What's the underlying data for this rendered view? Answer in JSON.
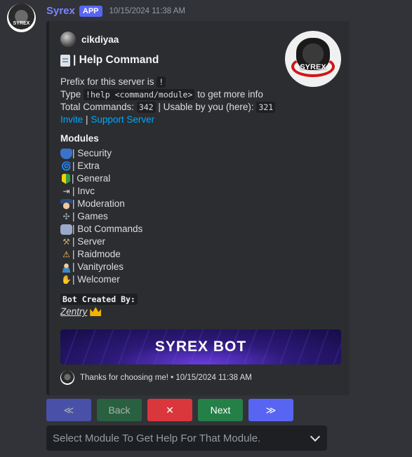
{
  "message": {
    "author": "Syrex",
    "badge": "APP",
    "timestamp": "10/15/2024 11:38 AM",
    "avatar_text": "SYREX"
  },
  "embed": {
    "author_name": "cikdiyaa",
    "thumbnail_text": "SYREX",
    "title": "| Help Command",
    "prefix_text": "Prefix for this server is",
    "prefix_value": "!",
    "type_text": "Type",
    "type_code": "!help <command/module>",
    "type_suffix": "to get more info",
    "total_label": "Total Commands:",
    "total_value": "342",
    "usable_label": "| Usable by you (here):",
    "usable_value": "321",
    "invite_label": "Invite",
    "separator": "|",
    "support_label": "Support Server",
    "modules_title": "Modules",
    "modules": [
      {
        "label": "| Security",
        "icon": "shield-icon"
      },
      {
        "label": "| Extra",
        "icon": "cyclone-icon"
      },
      {
        "label": "| General",
        "icon": "beginner-icon"
      },
      {
        "label": "| Invc",
        "icon": "arrow-icon"
      },
      {
        "label": "| Moderation",
        "icon": "police-icon"
      },
      {
        "label": "| Games",
        "icon": "game-icon"
      },
      {
        "label": "| Bot Commands",
        "icon": "robot-icon"
      },
      {
        "label": "| Server",
        "icon": "tools-icon"
      },
      {
        "label": "| Raidmode",
        "icon": "warning-icon"
      },
      {
        "label": "| Vanityroles",
        "icon": "person-icon"
      },
      {
        "label": "| Welcomer",
        "icon": "wave-icon"
      }
    ],
    "created_label": "Bot Created By:",
    "creator_name": "Zentry",
    "banner_text": "SYREX BOT",
    "footer_text": "Thanks for choosing me! • 10/15/2024 11:38 AM"
  },
  "buttons": {
    "first": "≪",
    "back": "Back",
    "stop": "✕",
    "next": "Next",
    "last": "≫"
  },
  "select": {
    "placeholder": "Select Module To Get Help For That Module."
  },
  "colors": {
    "accent": "#5865f2",
    "success": "#248046",
    "danger": "#da373c",
    "link": "#00a8fc"
  }
}
